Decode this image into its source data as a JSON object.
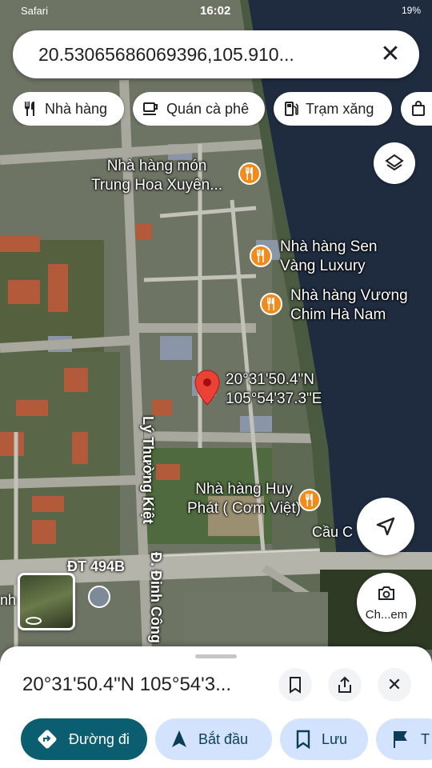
{
  "status_bar": {
    "carrier": "Safari",
    "time": "16:02",
    "battery": "19%"
  },
  "search": {
    "query": "20.5306568606939​6,105.910..."
  },
  "chips": [
    {
      "label": "Nhà hàng",
      "icon": "fork-knife-icon"
    },
    {
      "label": "Quán cà phê",
      "icon": "coffee-cup-icon"
    },
    {
      "label": "Trạm xăng",
      "icon": "gas-pump-icon"
    }
  ],
  "map": {
    "pois": [
      {
        "name": "Nhà hàng món\nTrung Hoa Xuyên...",
        "icon": "restaurant-icon"
      },
      {
        "name": "Nhà hàng Sen\nVàng Luxury",
        "icon": "restaurant-icon"
      },
      {
        "name": "Nhà hàng Vương\nChim Hà Nam",
        "icon": "restaurant-icon"
      },
      {
        "name": "Nhà hàng Huy\nPhát ( Cơm Việt)",
        "icon": "restaurant-icon"
      }
    ],
    "pin_label": "20°31'50.4\"N\n105°54'37.3\"E",
    "roads": {
      "ly_thuong_kiet": "Lý Thường Kiệt",
      "dt494b": "ĐT 494B",
      "dinh_cong": "Đ. Đinh Công",
      "cau": "Cầu C",
      "left_label": "nh"
    }
  },
  "lens_button": {
    "label": "Ch...em"
  },
  "bottom_sheet": {
    "title": "20°31'50.4\"N 105°54'3...",
    "actions": [
      {
        "label": "Đường đi",
        "icon": "directions-icon"
      },
      {
        "label": "Bắt đầu",
        "icon": "navigation-arrow-icon"
      },
      {
        "label": "Lưu",
        "icon": "bookmark-icon"
      },
      {
        "label": "T",
        "icon": "flag-icon"
      }
    ]
  },
  "colors": {
    "accent": "#0b57d0",
    "primary_button": "#0b5d70",
    "chip_blue": "#d3e3fd",
    "poi_orange": "#f28b1c",
    "pin_red": "#ea4335",
    "water": "#1e2b3e"
  }
}
